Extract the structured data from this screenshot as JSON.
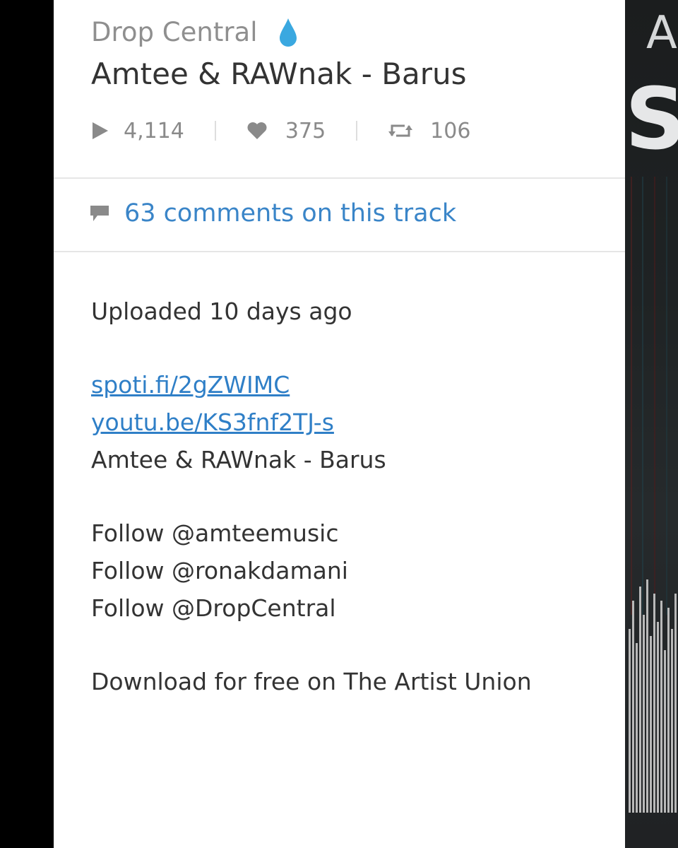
{
  "track": {
    "artist": "Drop Central",
    "title": "Amtee & RAWnak - Barus",
    "plays": "4,114",
    "likes": "375",
    "reposts": "106"
  },
  "comments": {
    "label": "63 comments on this track"
  },
  "description": {
    "uploaded": "Uploaded 10 days ago",
    "link_spotify": "spoti.fi/2gZWIMC",
    "link_youtube": "youtu.be/KS3fnf2TJ-s",
    "track_name": "Amtee & RAWnak - Barus",
    "follow_1": "Follow @amteemusic",
    "follow_2": "Follow @ronakdamani",
    "follow_3": "Follow @DropCentral",
    "download": "Download for free on The Artist Union"
  },
  "artwork": {
    "letter_top": "A",
    "letter_mid": "S"
  },
  "colors": {
    "accent": "#3a85c8",
    "drop": "#3aa8e0",
    "icon_gray": "#8a8a8a"
  },
  "icons": [
    "drop-icon",
    "play-icon",
    "heart-icon",
    "repost-icon",
    "comment-icon"
  ]
}
